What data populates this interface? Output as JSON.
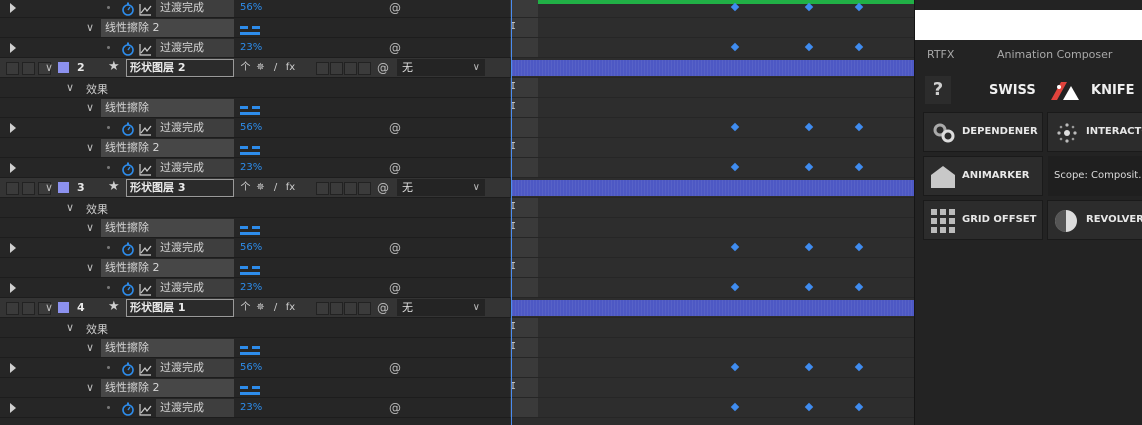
{
  "layers_panel": {
    "effects_group": "效果",
    "effect_name_1": "线性擦除",
    "effect_name_2": "线性擦除 2",
    "property_name": "过渡完成",
    "value_1": "56%",
    "value_2": "23%",
    "parent_none": "无",
    "layers": [
      {
        "num": "2",
        "name": "形状图层 2"
      },
      {
        "num": "3",
        "name": "形状图层 3"
      },
      {
        "num": "4",
        "name": "形状图层 1"
      }
    ]
  },
  "timeline": {
    "colors": {
      "layer_bar": "#4d58c4",
      "keyframe": "#3f8cf0",
      "work_area": "#21b046",
      "time_indicator": "#4a8cf0"
    }
  },
  "panel": {
    "tab_left": "RTFX",
    "tab_right": "Animation Composer",
    "help_icon_text": "?",
    "swiss_label": "SWISS",
    "knife_label": "KNIFE",
    "buttons": {
      "dependener": "DEPENDENER",
      "interactor": "INTERACTOR",
      "animarker": "ANIMARKER",
      "scope": "Scope: Composit...",
      "grid_offset": "GRID OFFSET",
      "revolver": "REVOLVER"
    },
    "colors": {
      "accent_red": "#e0433c"
    }
  }
}
